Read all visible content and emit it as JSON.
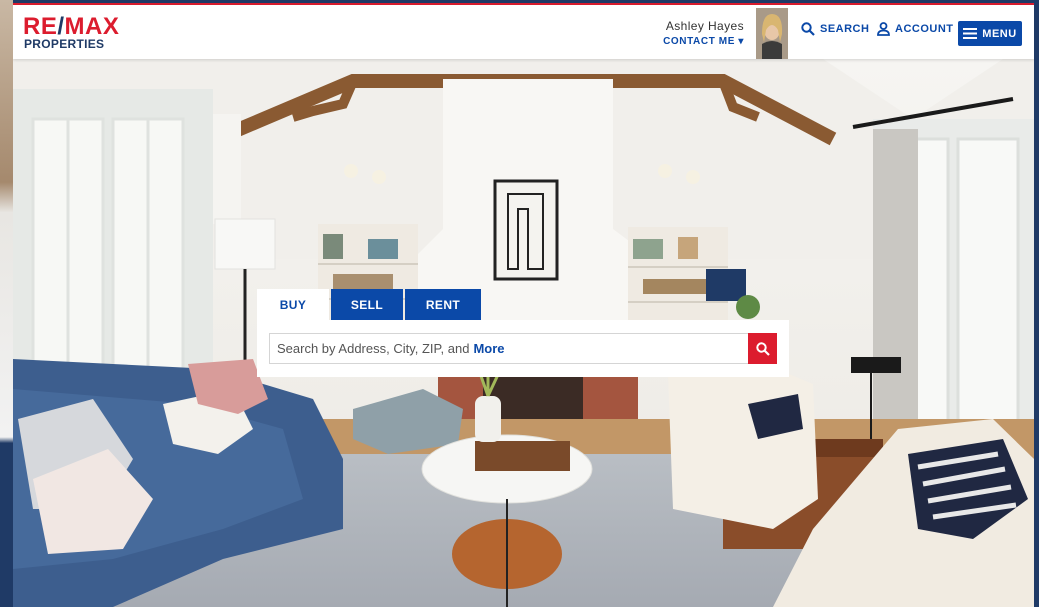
{
  "brand": {
    "logo_main": "RE/MAX",
    "logo_sub": "PROPERTIES",
    "red": "#dc1c2e",
    "blue": "#1f3a66"
  },
  "agent": {
    "name": "Ashley Hayes",
    "contact_label": "CONTACT ME",
    "contact_icon": "caret-down-icon"
  },
  "nav": {
    "search_label": "SEARCH",
    "search_icon": "search-icon",
    "account_label": "ACCOUNT",
    "account_icon": "user-icon",
    "menu_label": "MENU",
    "menu_icon": "hamburger-icon"
  },
  "search": {
    "tabs": [
      {
        "label": "BUY",
        "active": true
      },
      {
        "label": "SELL",
        "active": false
      },
      {
        "label": "RENT",
        "active": false
      }
    ],
    "placeholder": "Search by Address, City, ZIP, and",
    "placeholder_more": "More",
    "submit_icon": "search-icon"
  }
}
